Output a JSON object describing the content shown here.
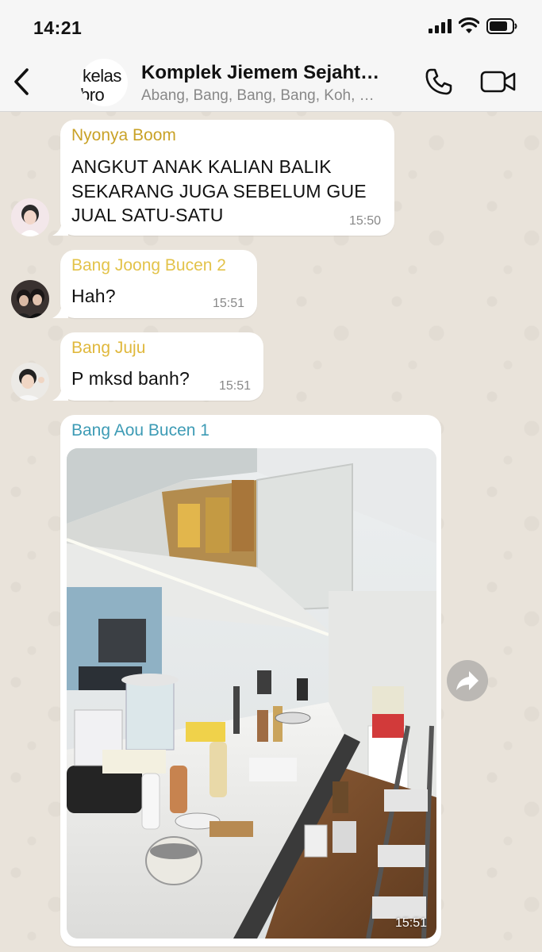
{
  "status_bar": {
    "time": "14:21"
  },
  "header": {
    "avatar_line1": "kelas",
    "avatar_line2": "bro",
    "title": "Komplek Jiemem Sejaht…",
    "members": "Abang, Bang, Bang, Bang, Koh, …"
  },
  "messages": [
    {
      "sender": "Nyonya Boom",
      "sender_color": "#c9a227",
      "lines": [
        "ANGKUT ANAK KALIAN BALIK",
        "SEKARANG JUGA SEBELUM GUE",
        "JUAL SATU-SATU"
      ],
      "time": "15:50"
    },
    {
      "sender": "Bang Joong Bucen 2",
      "sender_color": "#e3c34a",
      "text": "Hah?",
      "time": "15:51"
    },
    {
      "sender": "Bang Juju",
      "sender_color": "#e0b83c",
      "text": "P mksd banh?",
      "time": "15:51"
    },
    {
      "sender": "Bang Aou Bucen 1",
      "sender_color": "#3d9bb5",
      "image": "messy-kitchen-photo",
      "time": "15:51"
    }
  ],
  "icons": {
    "back": "chevron-left-icon",
    "call": "phone-icon",
    "video": "video-camera-icon",
    "forward": "share-forward-icon"
  }
}
